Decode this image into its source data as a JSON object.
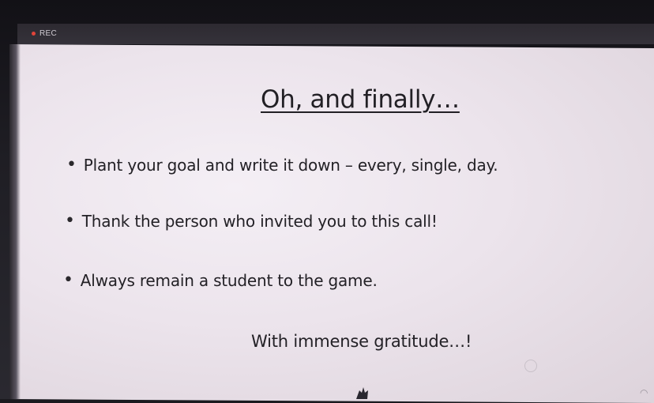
{
  "recording": {
    "label": "REC",
    "dot_color": "#e0443a"
  },
  "slide": {
    "title": "Oh, and finally…",
    "bullets": [
      "Plant your goal and write it down – every, single, day.",
      "Thank the person who invited you to this call!",
      "Always remain a student to the game."
    ],
    "closing": "With immense gratitude…!"
  }
}
